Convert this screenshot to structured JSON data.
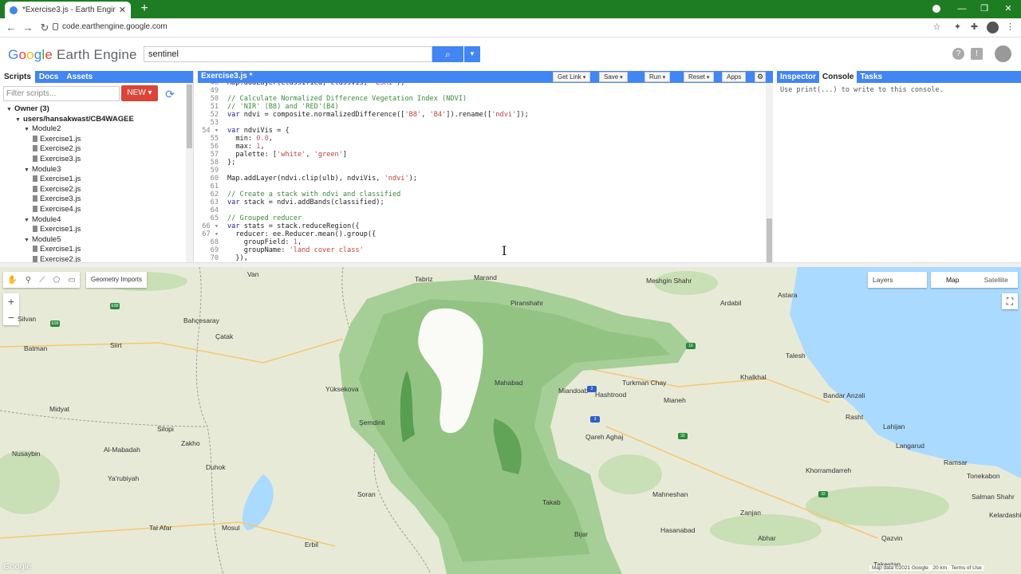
{
  "browser": {
    "tab_title": "*Exercise3.js - Earth Engine Code",
    "url": "code.earthengine.google.com",
    "window_controls": [
      "—",
      "❐",
      "✕"
    ]
  },
  "header": {
    "logo_google": [
      "G",
      "o",
      "o",
      "g",
      "l",
      "e"
    ],
    "logo_product": "Earth Engine",
    "search_value": "sentinel"
  },
  "left_panel": {
    "tabs": [
      "Scripts",
      "Docs",
      "Assets"
    ],
    "filter_placeholder": "Filter scripts...",
    "new_button": "NEW",
    "tree": [
      {
        "label": "Owner (3)",
        "level": 0,
        "kind": "folder"
      },
      {
        "label": "users/hansakwast/CB4WAGEE",
        "level": 1,
        "kind": "folder"
      },
      {
        "label": "Module2",
        "level": 2,
        "kind": "folder"
      },
      {
        "label": "Exercise1.js",
        "level": 3,
        "kind": "file"
      },
      {
        "label": "Exercise2.js",
        "level": 3,
        "kind": "file"
      },
      {
        "label": "Exercise3.js",
        "level": 3,
        "kind": "file"
      },
      {
        "label": "Module3",
        "level": 2,
        "kind": "folder"
      },
      {
        "label": "Exercise1.js",
        "level": 3,
        "kind": "file"
      },
      {
        "label": "Exercise2.js",
        "level": 3,
        "kind": "file"
      },
      {
        "label": "Exercise3.js",
        "level": 3,
        "kind": "file"
      },
      {
        "label": "Exercise4.js",
        "level": 3,
        "kind": "file"
      },
      {
        "label": "Module4",
        "level": 2,
        "kind": "folder"
      },
      {
        "label": "Exercise1.js",
        "level": 3,
        "kind": "file"
      },
      {
        "label": "Module5",
        "level": 2,
        "kind": "folder"
      },
      {
        "label": "Exercise1.js",
        "level": 3,
        "kind": "file"
      },
      {
        "label": "Exercise2.js",
        "level": 3,
        "kind": "file"
      }
    ]
  },
  "editor": {
    "title": "Exercise3.js *",
    "buttons": {
      "get_link": "Get Link",
      "save": "Save",
      "run": "Run",
      "reset": "Reset",
      "apps": "Apps"
    },
    "lines": [
      {
        "n": "48",
        "text": "Map.addLayer(classified, classVis, 'ESRI');"
      },
      {
        "n": "49",
        "text": ""
      },
      {
        "n": "50",
        "text": "// Calculate Normalized Difference Vegetation Index (NDVI)"
      },
      {
        "n": "51",
        "text": "// 'NIR' (B8) and 'RED'(B4)"
      },
      {
        "n": "52",
        "text": "var ndvi = composite.normalizedDifference(['B8', 'B4']).rename(['ndvi']);"
      },
      {
        "n": "53",
        "text": ""
      },
      {
        "n": "54 ▾",
        "text": "var ndviVis = {"
      },
      {
        "n": "55",
        "text": "  min: 0.0,"
      },
      {
        "n": "56",
        "text": "  max: 1,"
      },
      {
        "n": "57",
        "text": "  palette: ['white', 'green']"
      },
      {
        "n": "58",
        "text": "};"
      },
      {
        "n": "59",
        "text": ""
      },
      {
        "n": "60",
        "text": "Map.addLayer(ndvi.clip(ulb), ndviVis, 'ndvi');"
      },
      {
        "n": "61",
        "text": ""
      },
      {
        "n": "62",
        "text": "// Create a stack with ndvi and classified"
      },
      {
        "n": "63",
        "text": "var stack = ndvi.addBands(classified);"
      },
      {
        "n": "64",
        "text": ""
      },
      {
        "n": "65",
        "text": "// Grouped reducer"
      },
      {
        "n": "66 ▾",
        "text": "var stats = stack.reduceRegion({"
      },
      {
        "n": "67 ▾",
        "text": "  reducer: ee.Reducer.mean().group({"
      },
      {
        "n": "68",
        "text": "    groupField: 1,"
      },
      {
        "n": "69",
        "text": "    groupName: 'land cover class'"
      },
      {
        "n": "70",
        "text": "  }),"
      }
    ]
  },
  "right_panel": {
    "tabs": [
      "Inspector",
      "Console",
      "Tasks"
    ],
    "console_message": "Use print(...) to write to this console."
  },
  "map": {
    "geometry_imports": "Geometry Imports",
    "layers_button": "Layers",
    "map_types": [
      "Map",
      "Satellite"
    ],
    "attribution": [
      "Map data ©2021 Google",
      "20 km",
      "Terms of Use"
    ],
    "google_logo": "Google",
    "labels": [
      "Van",
      "Marand",
      "Meshgin Shahr",
      "Ardabil",
      "Astara",
      "Bahçesaray",
      "Siirt",
      "Batman",
      "Silvan",
      "Çatak",
      "Tabriz",
      "Yüksekova",
      "Midyat",
      "Şemdinli",
      "Silopi",
      "Zakho",
      "Nusaybin",
      "Al-Mabadah",
      "Duhok",
      "Ya'rubiyah",
      "Mosul",
      "Tal Afar",
      "Erbil",
      "Piranshahr",
      "Mahabad",
      "Miandoab",
      "Mianeh",
      "Hashtrood",
      "Turkman Chay",
      "Qareh Aghaj",
      "Zanjan",
      "Khalkhal",
      "Talesh",
      "Bandar Anzali",
      "Rasht",
      "Lahijan",
      "Langarud",
      "Ramsar",
      "Tonekabon",
      "Salman Shahr",
      "Kelardasht",
      "Qazvin",
      "Takestan",
      "Soran",
      "Takab",
      "Bijar",
      "Mahneshan",
      "Hasanabad",
      "Abhar",
      "Khorramdarreh"
    ]
  },
  "colors": {
    "chrome_green": "#1e7d22",
    "ee_blue": "#4285f4",
    "new_red": "#db4437",
    "ndvi_green": "#2f8a36"
  }
}
